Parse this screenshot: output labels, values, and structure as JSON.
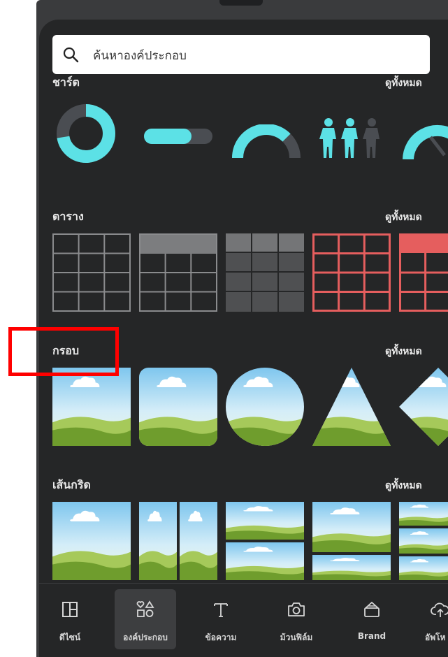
{
  "search": {
    "placeholder": "ค้นหาองค์ประกอบ",
    "icon": "search-icon"
  },
  "sections": {
    "charts": {
      "title": "ชาร์ต",
      "see_all": "ดูทั้งหมด"
    },
    "tables": {
      "title": "ตาราง",
      "see_all": "ดูทั้งหมด"
    },
    "frames": {
      "title": "กรอบ",
      "see_all": "ดูทั้งหมด"
    },
    "grids": {
      "title": "เส้นกริด",
      "see_all": "ดูทั้งหมด"
    }
  },
  "tabs": [
    {
      "label": "ดีไซน์",
      "icon": "layout-icon"
    },
    {
      "label": "องค์ประกอบ",
      "icon": "elements-icon",
      "active": true
    },
    {
      "label": "ข้อความ",
      "icon": "text-icon"
    },
    {
      "label": "ม้วนฟิล์ม",
      "icon": "camera-icon"
    },
    {
      "label": "Brand",
      "icon": "brand-icon"
    },
    {
      "label": "อัพโห",
      "icon": "upload-icon"
    }
  ],
  "colors": {
    "accent": "#5ce1e6",
    "table_red": "#e55e5e",
    "panel": "#252627",
    "highlight": "#ff0000"
  }
}
